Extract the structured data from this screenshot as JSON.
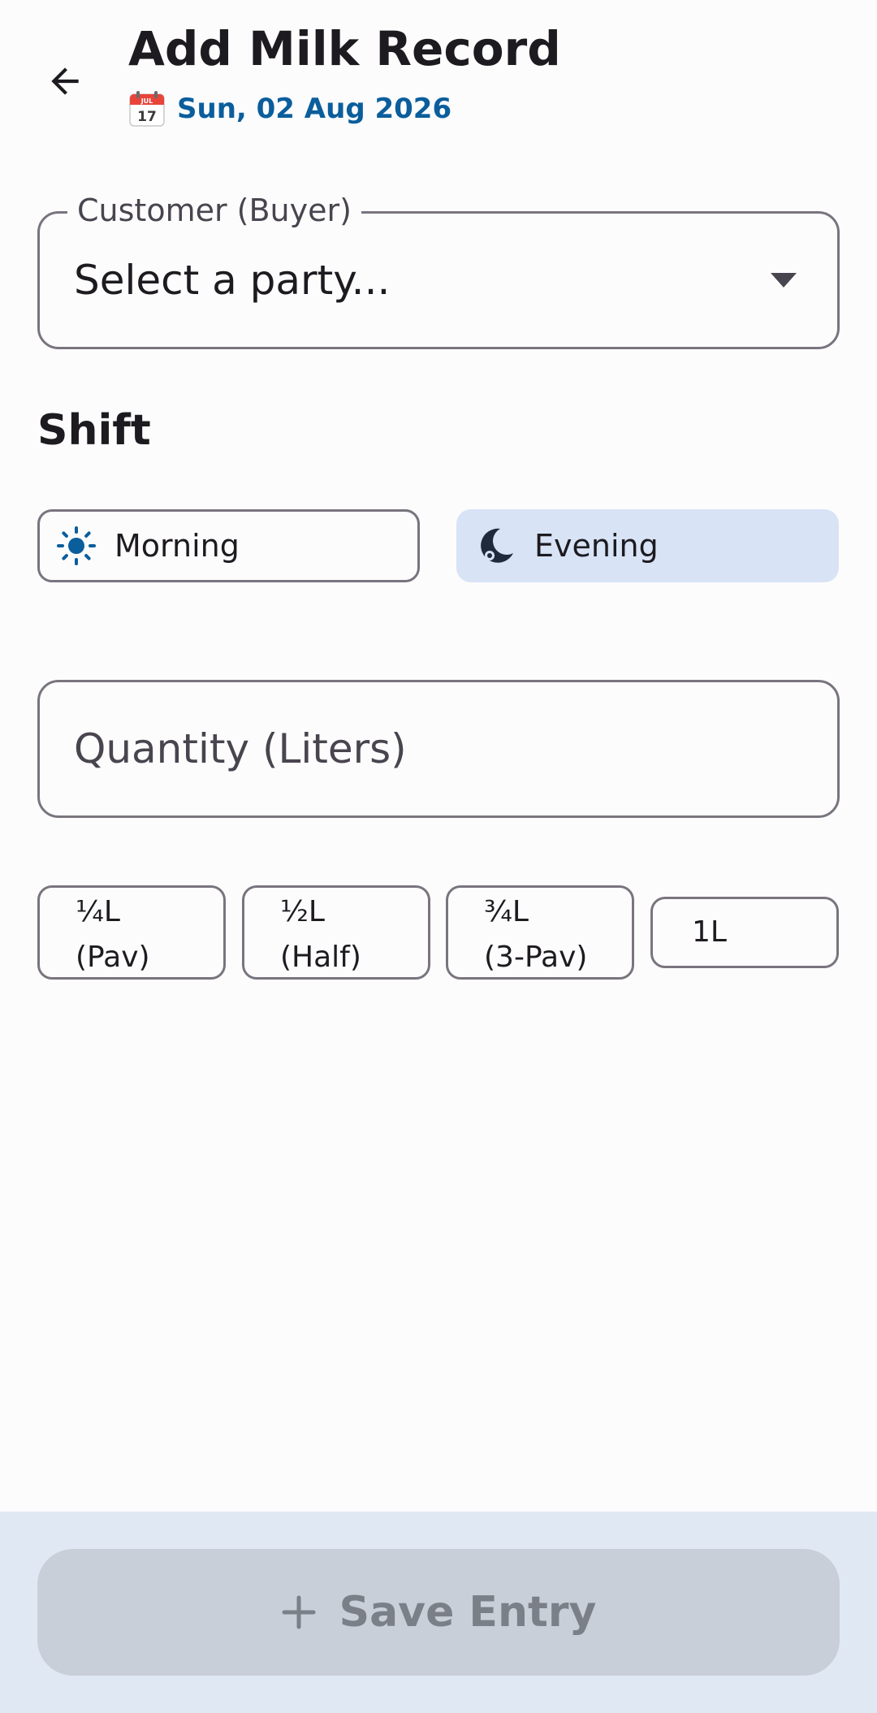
{
  "header": {
    "title": "Add Milk Record",
    "date": "Sun, 02 Aug 2026",
    "calendar_icon": "calendar-icon",
    "calendar_month": "JUL",
    "calendar_day": "17",
    "back_icon": "arrow-left-icon"
  },
  "customer": {
    "label": "Customer (Buyer)",
    "value": "Select a party..."
  },
  "shift": {
    "title": "Shift",
    "options": [
      {
        "label": "Morning",
        "icon": "sun-icon",
        "selected": false
      },
      {
        "label": "Evening",
        "icon": "moon-icon",
        "selected": true
      }
    ]
  },
  "quantity": {
    "placeholder": "Quantity (Liters)"
  },
  "presets": [
    {
      "line1": "¼L",
      "line2": "(Pav)"
    },
    {
      "line1": "½L",
      "line2": "(Half)"
    },
    {
      "line1": "¾L",
      "line2": "(3-Pav)"
    },
    {
      "line1": "1L"
    }
  ],
  "footer": {
    "save_label": "Save Entry",
    "save_icon": "plus-icon",
    "save_enabled": false
  },
  "colors": {
    "accent": "#0b5e9c",
    "selected_bg": "#d8e3f6",
    "outline": "#79747e",
    "bottom_bar": "#e0e9f3",
    "disabled_button": "#c8cfd8"
  }
}
